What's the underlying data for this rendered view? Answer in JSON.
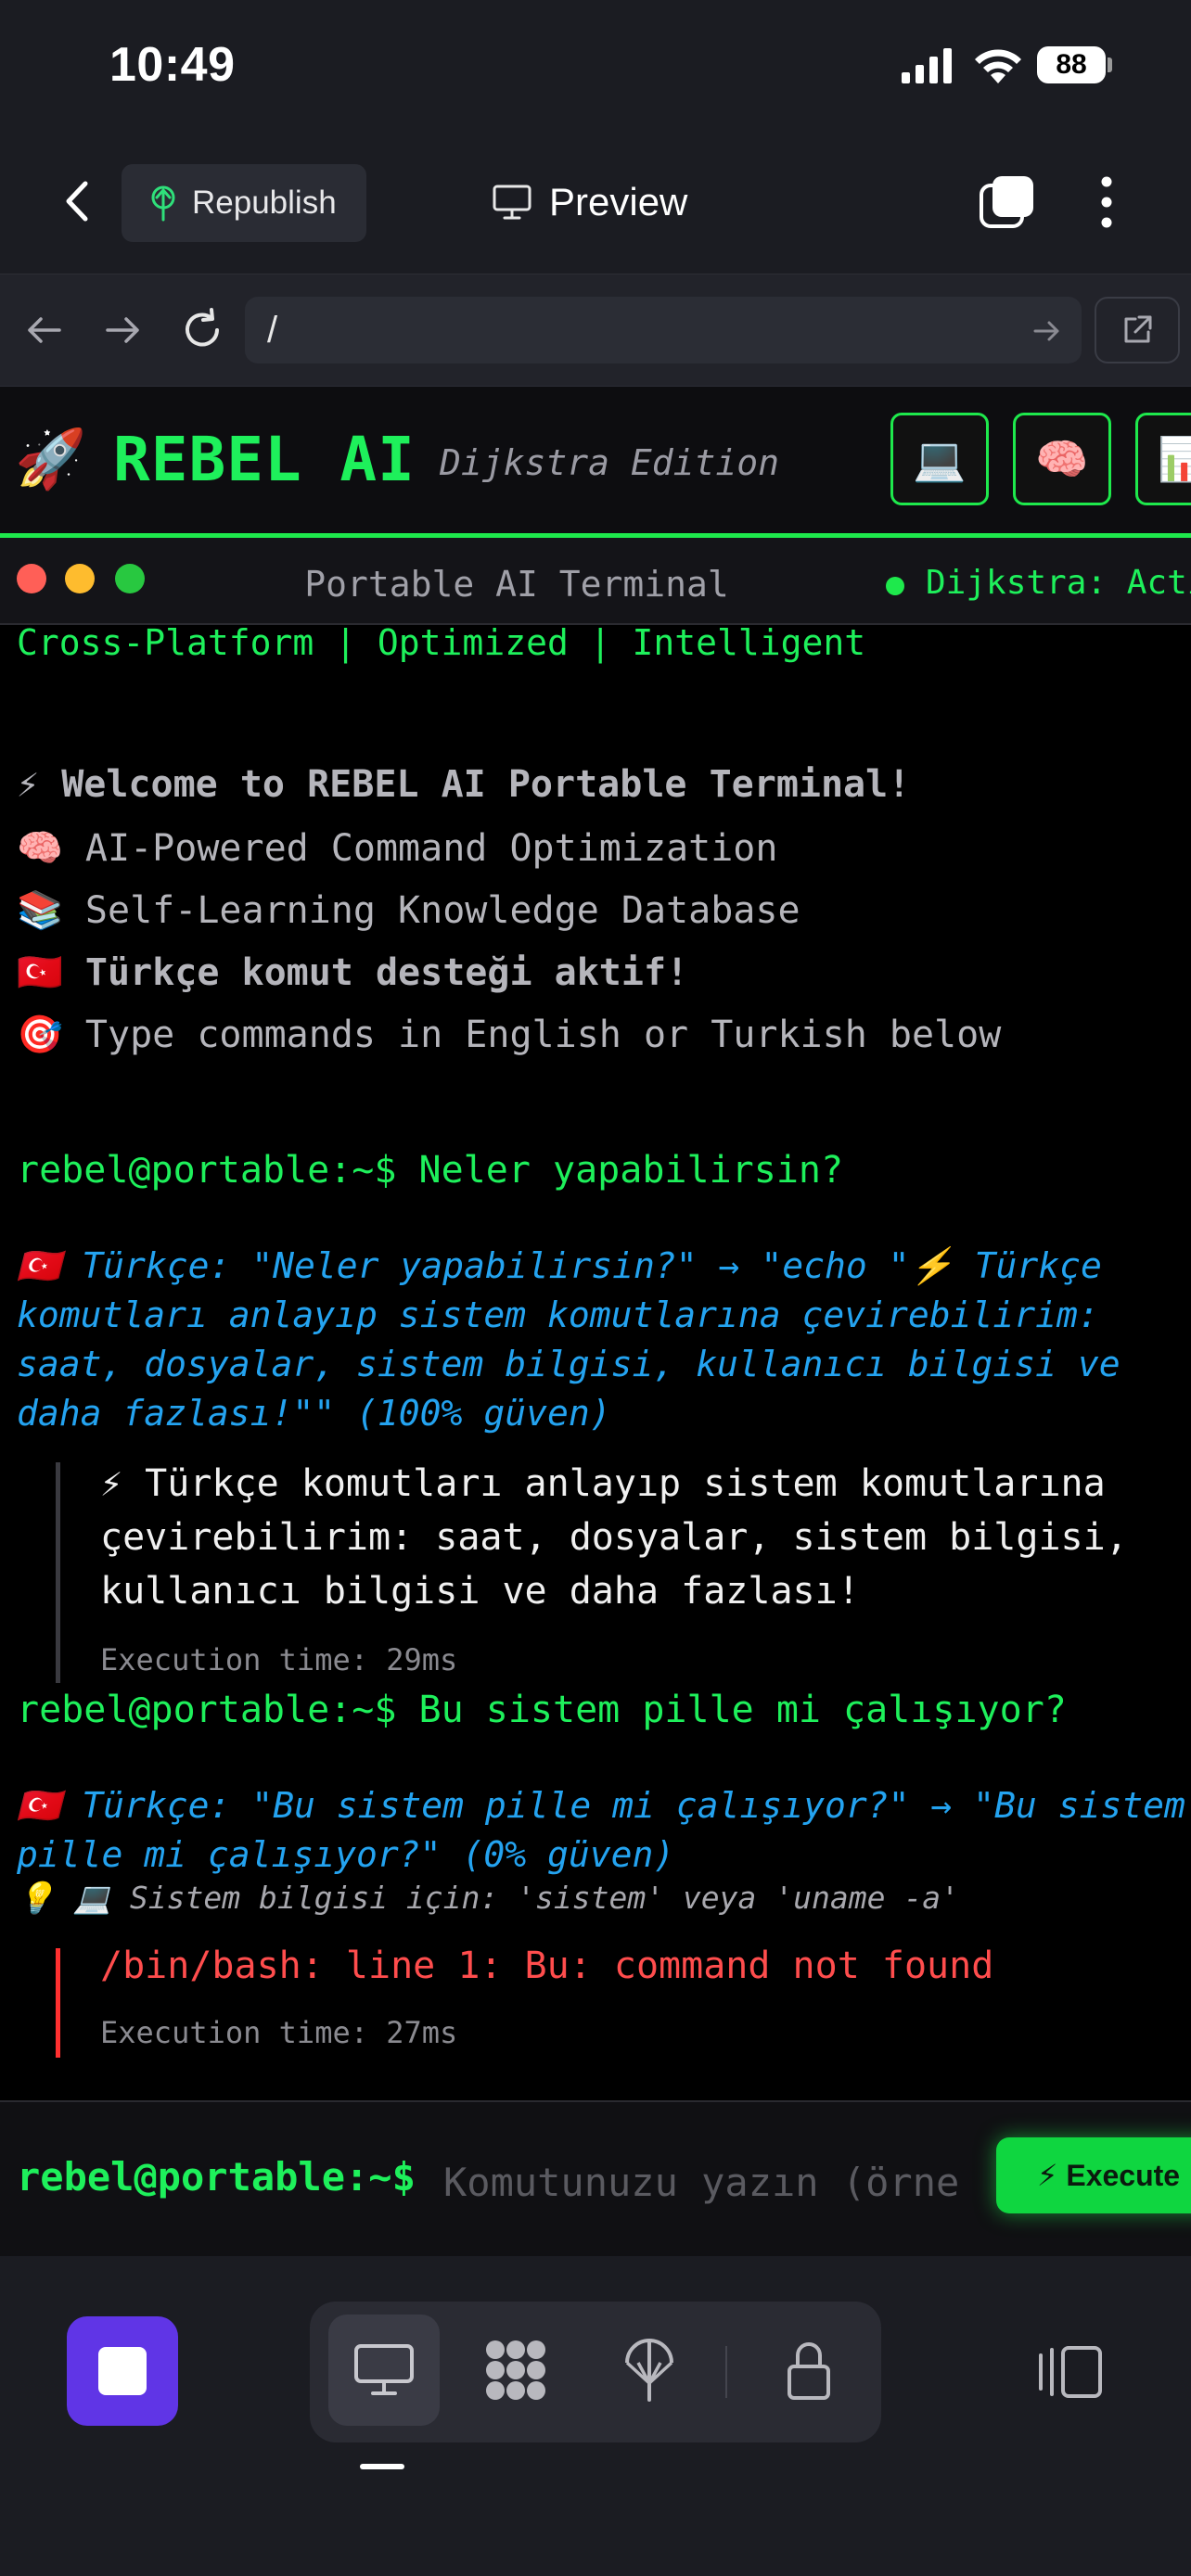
{
  "status_bar": {
    "time": "10:49",
    "battery": "88"
  },
  "app_bar": {
    "republish_label": "Republish",
    "preview_label": "Preview"
  },
  "browser": {
    "url": "/"
  },
  "rebel": {
    "rocket": "🚀",
    "brand": "REBEL AI",
    "edition": "Dijkstra Edition",
    "header_buttons": [
      "💻",
      "🧠",
      "📊"
    ]
  },
  "terminal": {
    "title": "Portable AI Terminal",
    "status": "Dijkstra: Acti",
    "tagline": "Cross-Platform | Optimized | Intelligent",
    "welcome": [
      {
        "icon": "⚡",
        "text": "Welcome to REBEL AI Portable Terminal!"
      },
      {
        "icon": "🧠",
        "text": "AI-Powered Command Optimization"
      },
      {
        "icon": "📚",
        "text": "Self-Learning Knowledge Database"
      },
      {
        "icon": "🇹🇷",
        "text": "Türkçe komut desteği aktif!"
      },
      {
        "icon": "🎯",
        "text": "Type commands in English or Turkish below"
      }
    ],
    "entries": [
      {
        "prompt": "rebel@portable:~$",
        "command": "Neler yapabilirsin?",
        "translation_flag": "🇹🇷",
        "translation_lines": [
          "Türkçe: \"Neler yapabilirsin?\" → \"echo \"⚡ Türkçe",
          "komutları anlayıp sistem komutlarına çevirebilirim:",
          "saat, dosyalar, sistem bilgisi, kullanıcı bilgisi ve",
          "daha fazlası!\"\" (100% güven)"
        ],
        "output_lines": [
          "⚡ Türkçe komutları anlayıp sistem komutlarına",
          "çevirebilirim: saat, dosyalar, sistem bilgisi,",
          "kullanıcı bilgisi ve daha fazlası!"
        ],
        "exec_time": "Execution time: 29ms"
      },
      {
        "prompt": "rebel@portable:~$",
        "command": "Bu sistem pille mi çalışıyor?",
        "translation_flag": "🇹🇷",
        "translation_lines": [
          "Türkçe: \"Bu sistem pille mi çalışıyor?\" → \"Bu sistem",
          "pille mi çalışıyor?\" (0% güven)"
        ],
        "hint": "💡 💻 Sistem bilgisi için: 'sistem' veya 'uname -a'",
        "error": "/bin/bash: line 1: Bu: command not found",
        "exec_time": "Execution time: 27ms"
      }
    ],
    "input_prompt": "rebel@portable:~$",
    "input_placeholder": "Komutunuzu yazın (örnek: saat, dosyalar)",
    "execute_label": "⚡ Execute"
  }
}
